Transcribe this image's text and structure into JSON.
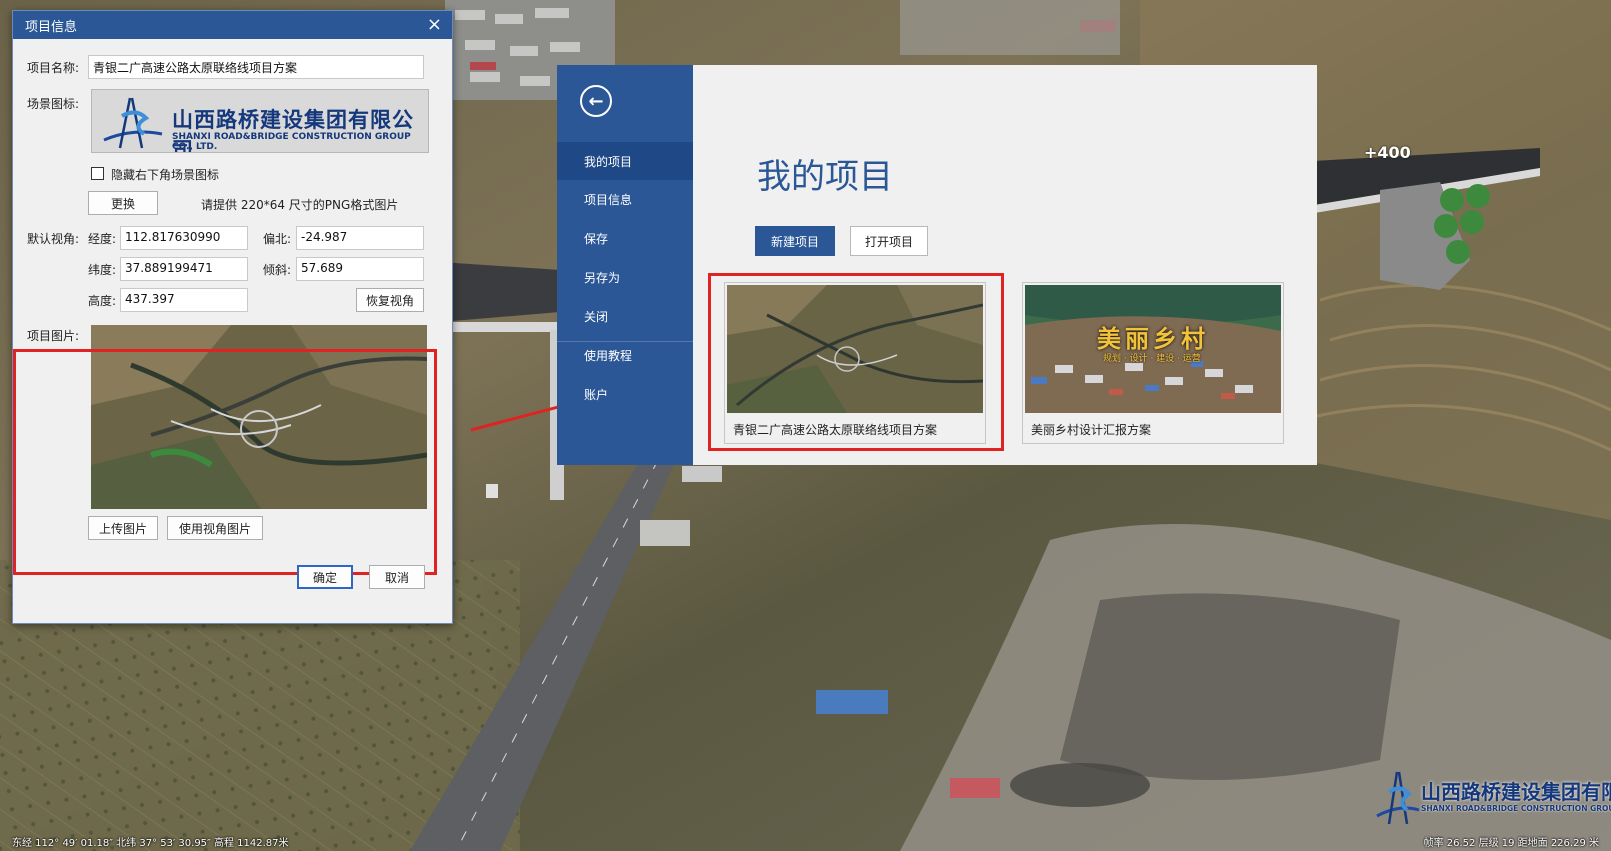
{
  "scene": {
    "elevation_marker": "+400",
    "status_left": "东经 112° 49′ 01.18″ 北纬 37° 53′ 30.95″ 高程 1142.87米",
    "status_right": "帧率 26.52  层级 19  距地面 226.29 米",
    "logo_cn": "山西路桥建设集团有限公司",
    "logo_en": "SHANXI ROAD&BRIDGE CONSTRUCTION GROUP CO., LTD."
  },
  "info_dialog": {
    "title": "项目信息",
    "close_glyph": "×",
    "name_label": "项目名称:",
    "name_value": "青银二广高速公路太原联络线项目方案",
    "scene_icon_label": "场景图标:",
    "logo_cn": "山西路桥建设集团有限公司",
    "logo_en": "SHANXI ROAD&BRIDGE CONSTRUCTION GROUP CO., LTD.",
    "hide_logo_label": "隐藏右下角场景图标",
    "hide_logo_checked": false,
    "replace_button": "更换",
    "png_hint": "请提供 220*64 尺寸的PNG格式图片",
    "default_view_label": "默认视角:",
    "longitude_label": "经度:",
    "longitude_value": "112.817630990",
    "heading_label": "偏北:",
    "heading_value": "-24.987",
    "latitude_label": "纬度:",
    "latitude_value": "37.889199471",
    "tilt_label": "倾斜:",
    "tilt_value": "57.689",
    "height_label": "高度:",
    "height_value": "437.397",
    "restore_view_button": "恢复视角",
    "project_image_label": "项目图片:",
    "upload_image_button": "上传图片",
    "use_view_image_button": "使用视角图片",
    "ok_button": "确定",
    "cancel_button": "取消"
  },
  "backstage": {
    "back_glyph": "←",
    "nav": [
      {
        "label": "我的项目",
        "active": true
      },
      {
        "label": "项目信息",
        "active": false
      },
      {
        "label": "保存",
        "active": false
      },
      {
        "label": "另存为",
        "active": false
      },
      {
        "label": "关闭",
        "active": false
      },
      {
        "label": "使用教程",
        "active": false
      },
      {
        "label": "账户",
        "active": false
      }
    ],
    "title": "我的项目",
    "new_project_button": "新建项目",
    "open_project_button": "打开项目",
    "projects": [
      {
        "name": "青银二广高速公路太原联络线项目方案"
      },
      {
        "name": "美丽乡村设计汇报方案",
        "thumb_title": "美丽乡村",
        "thumb_subtitle": "规划 · 设计 · 建设 · 运营"
      }
    ]
  },
  "colors": {
    "accent": "#2b5797",
    "highlight": "#e12222"
  }
}
